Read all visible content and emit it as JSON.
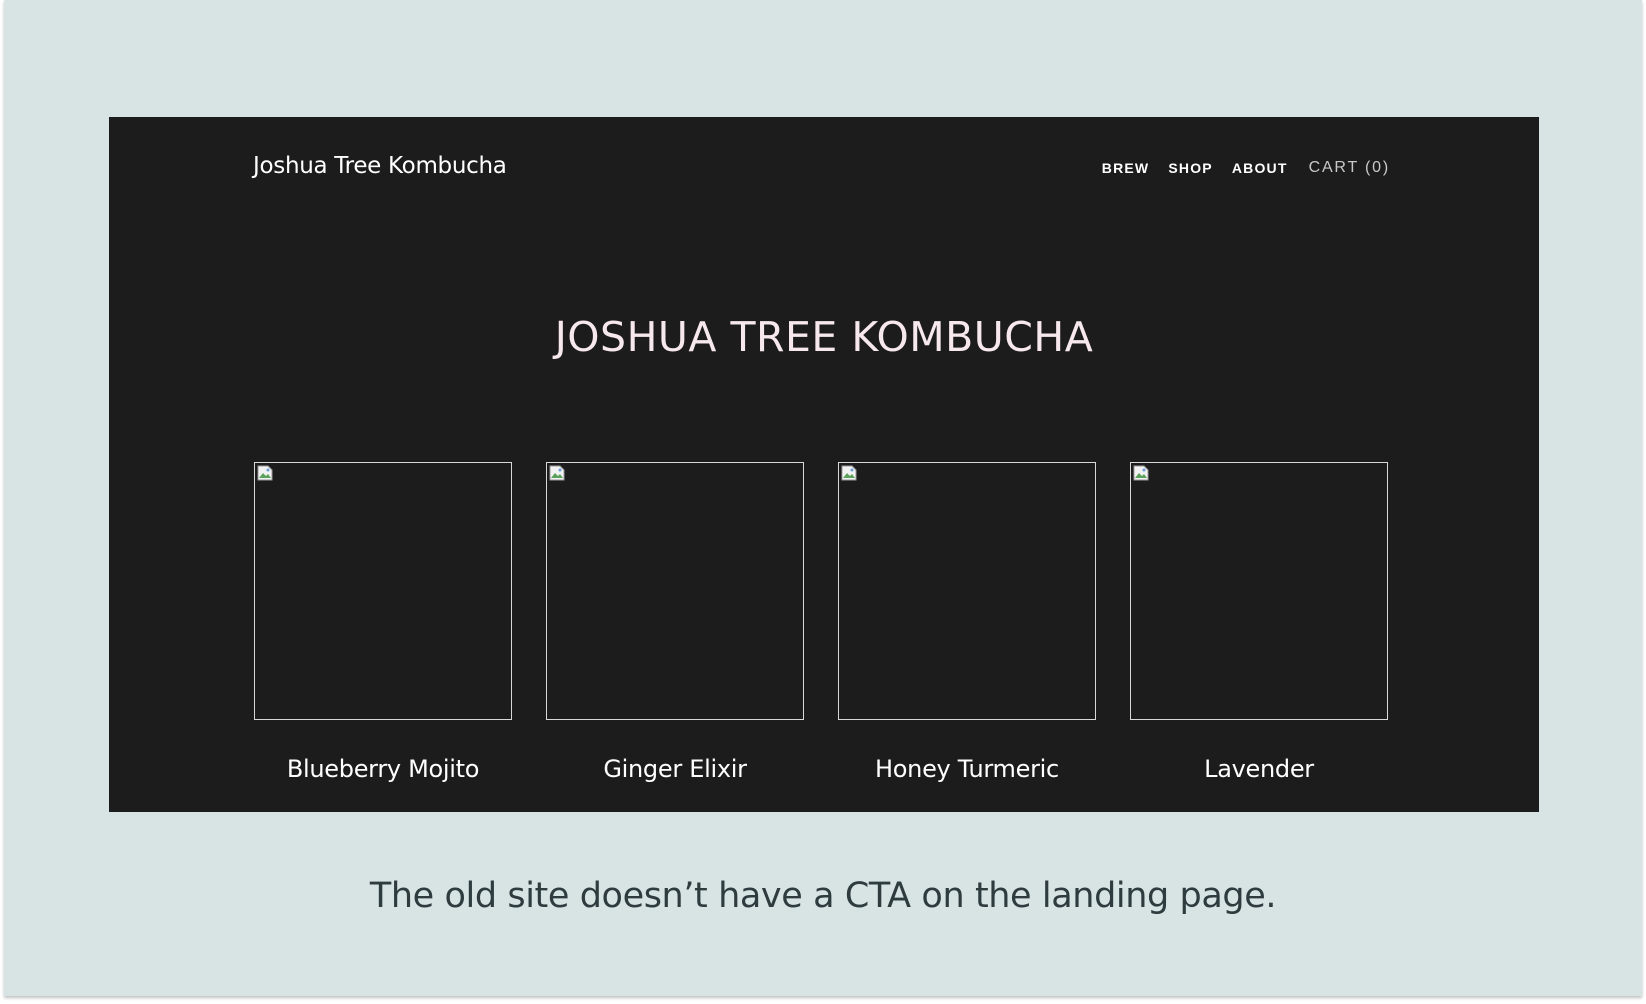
{
  "header": {
    "brand": "Joshua Tree Kombucha",
    "nav": [
      {
        "label": "BREW"
      },
      {
        "label": "SHOP"
      },
      {
        "label": "ABOUT"
      }
    ],
    "cart_label": "CART (0)"
  },
  "hero": {
    "title": "JOSHUA TREE KOMBUCHA"
  },
  "products": [
    {
      "name": "Blueberry Mojito",
      "image_icon": "broken-image-icon"
    },
    {
      "name": "Ginger Elixir",
      "image_icon": "broken-image-icon"
    },
    {
      "name": "Honey Turmeric",
      "image_icon": "broken-image-icon"
    },
    {
      "name": "Lavender",
      "image_icon": "broken-image-icon"
    }
  ],
  "caption": "The old site doesn’t have a CTA on the landing page.",
  "colors": {
    "slide_background": "#d8e4e4",
    "site_background": "#1c1c1c",
    "hero_title": "#f6e8ec",
    "caption_text": "#2e3b3f"
  }
}
